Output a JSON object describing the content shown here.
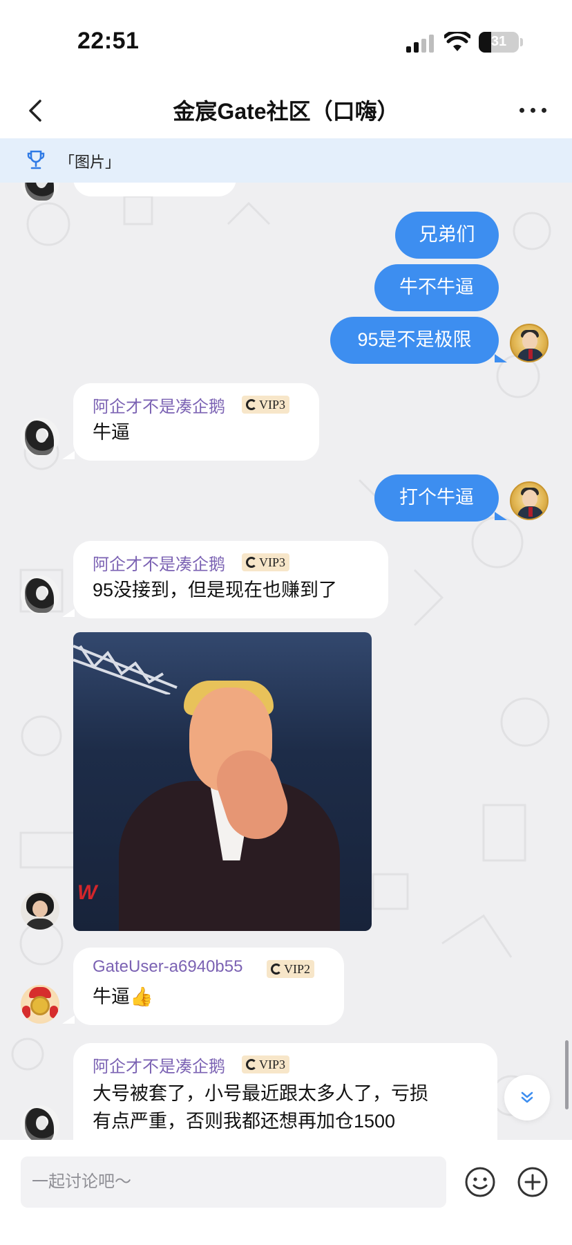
{
  "status_bar": {
    "time": "22:51",
    "battery_level": "31"
  },
  "nav": {
    "title": "金宸Gate社区（口嗨）"
  },
  "pinned": {
    "text": "「图片」"
  },
  "messages": {
    "m1": {
      "text": "兄弟们"
    },
    "m2": {
      "text": "牛不牛逼"
    },
    "m3": {
      "text": "95是不是极限"
    },
    "m4": {
      "user": "阿企才不是凑企鹅",
      "vip": "VIP3",
      "text": "牛逼"
    },
    "m5": {
      "text": "打个牛逼"
    },
    "m6": {
      "user": "阿企才不是凑企鹅",
      "vip": "VIP3",
      "text": "95没接到，但是现在也赚到了"
    },
    "m8": {
      "user": "GateUser-a6940b55",
      "vip": "VIP2",
      "text": "牛逼👍"
    },
    "m9": {
      "user": "阿企才不是凑企鹅",
      "vip": "VIP3",
      "line1": "大号被套了，小号最近跟太多人了，亏损",
      "line2": "有点严重，否则我都还想再加仓1500"
    }
  },
  "input": {
    "placeholder": "一起讨论吧～"
  },
  "colors": {
    "bubble_out": "#3d8ef0",
    "username": "#7b62b3",
    "vip_badge": "#f7e6c9",
    "pinned_bg": "#e4effb"
  },
  "icons": {
    "back": "chevron-left-icon",
    "more": "more-dots-icon",
    "pinned": "trophy-icon",
    "emoji": "smiley-icon",
    "plus": "plus-circle-icon",
    "jump": "double-chevron-down-icon"
  }
}
